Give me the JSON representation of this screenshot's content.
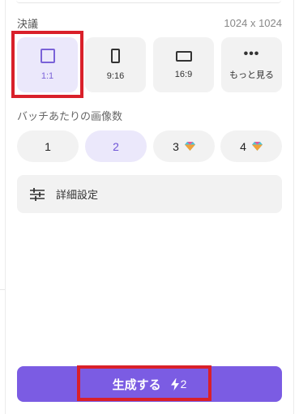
{
  "section": {
    "label": "決議",
    "resolution": "1024 x 1024"
  },
  "aspect_ratios": [
    {
      "label": "1:1",
      "icon": "square-icon",
      "selected": true
    },
    {
      "label": "9:16",
      "icon": "portrait-rect-icon",
      "selected": false
    },
    {
      "label": "16:9",
      "icon": "landscape-rect-icon",
      "selected": false
    },
    {
      "label": "もっと見る",
      "icon": "more-dots-icon",
      "selected": false
    }
  ],
  "batch": {
    "label": "バッチあたりの画像数",
    "options": [
      {
        "label": "1",
        "selected": false,
        "premium": false
      },
      {
        "label": "2",
        "selected": true,
        "premium": false
      },
      {
        "label": "3",
        "selected": false,
        "premium": true
      },
      {
        "label": "4",
        "selected": false,
        "premium": true
      }
    ]
  },
  "advanced": {
    "label": "詳細設定",
    "icon": "sliders-icon"
  },
  "generate": {
    "label": "生成する",
    "credits": "2",
    "icon": "bolt-icon"
  },
  "colors": {
    "accent": "#7b5ce3",
    "selected_bg": "#ebe8fb",
    "button_bg": "#f2f2f2",
    "highlight_box": "#d9202a"
  }
}
